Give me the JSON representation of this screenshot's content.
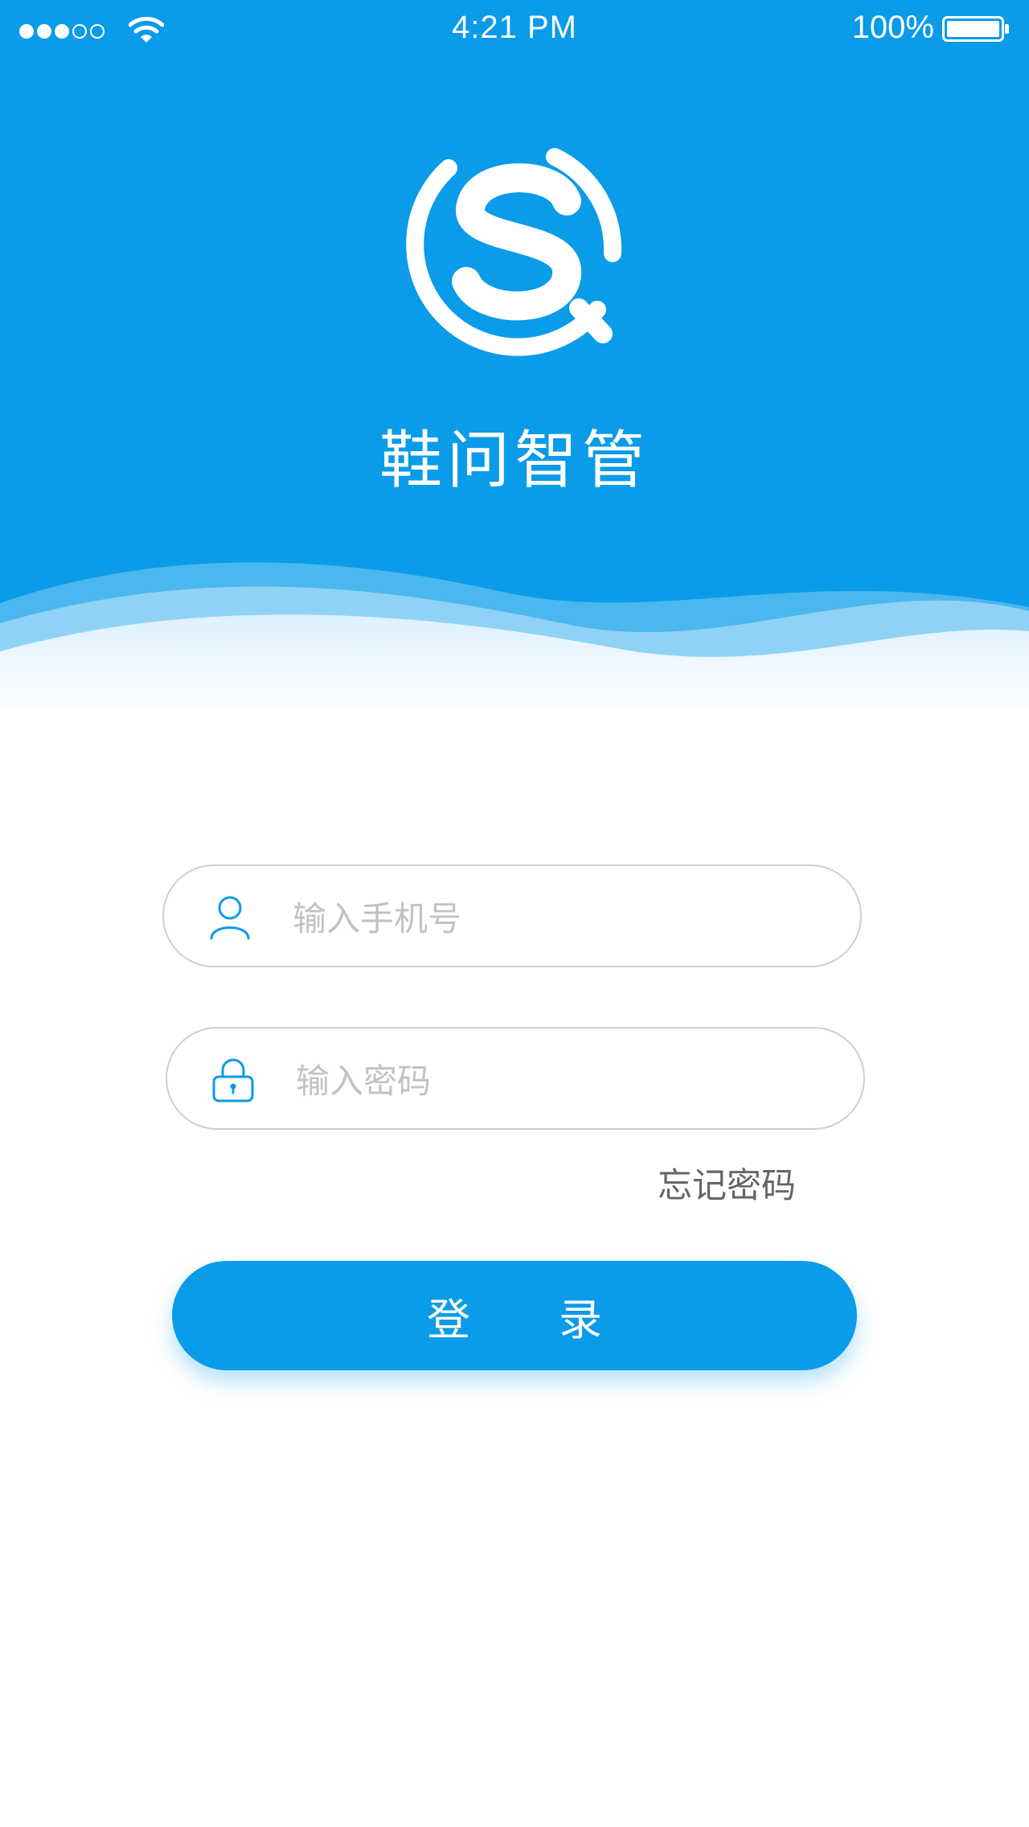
{
  "status_bar": {
    "time": "4:21 PM",
    "battery_percent": "100%",
    "signal_bars_filled": 3,
    "signal_bars_total": 5
  },
  "app": {
    "name": "鞋问智管",
    "logo_icon": "search-s-logo-icon"
  },
  "form": {
    "phone_placeholder": "输入手机号",
    "password_placeholder": "输入密码",
    "phone_icon": "user-icon",
    "password_icon": "lock-icon",
    "forgot_password_label": "忘记密码",
    "login_label_part1": "登",
    "login_label_part2": "录"
  },
  "colors": {
    "brand_blue": "#0a9be9",
    "placeholder_gray": "#c2c2c2",
    "link_gray": "#666666",
    "border_gray": "#cfcfcf"
  }
}
